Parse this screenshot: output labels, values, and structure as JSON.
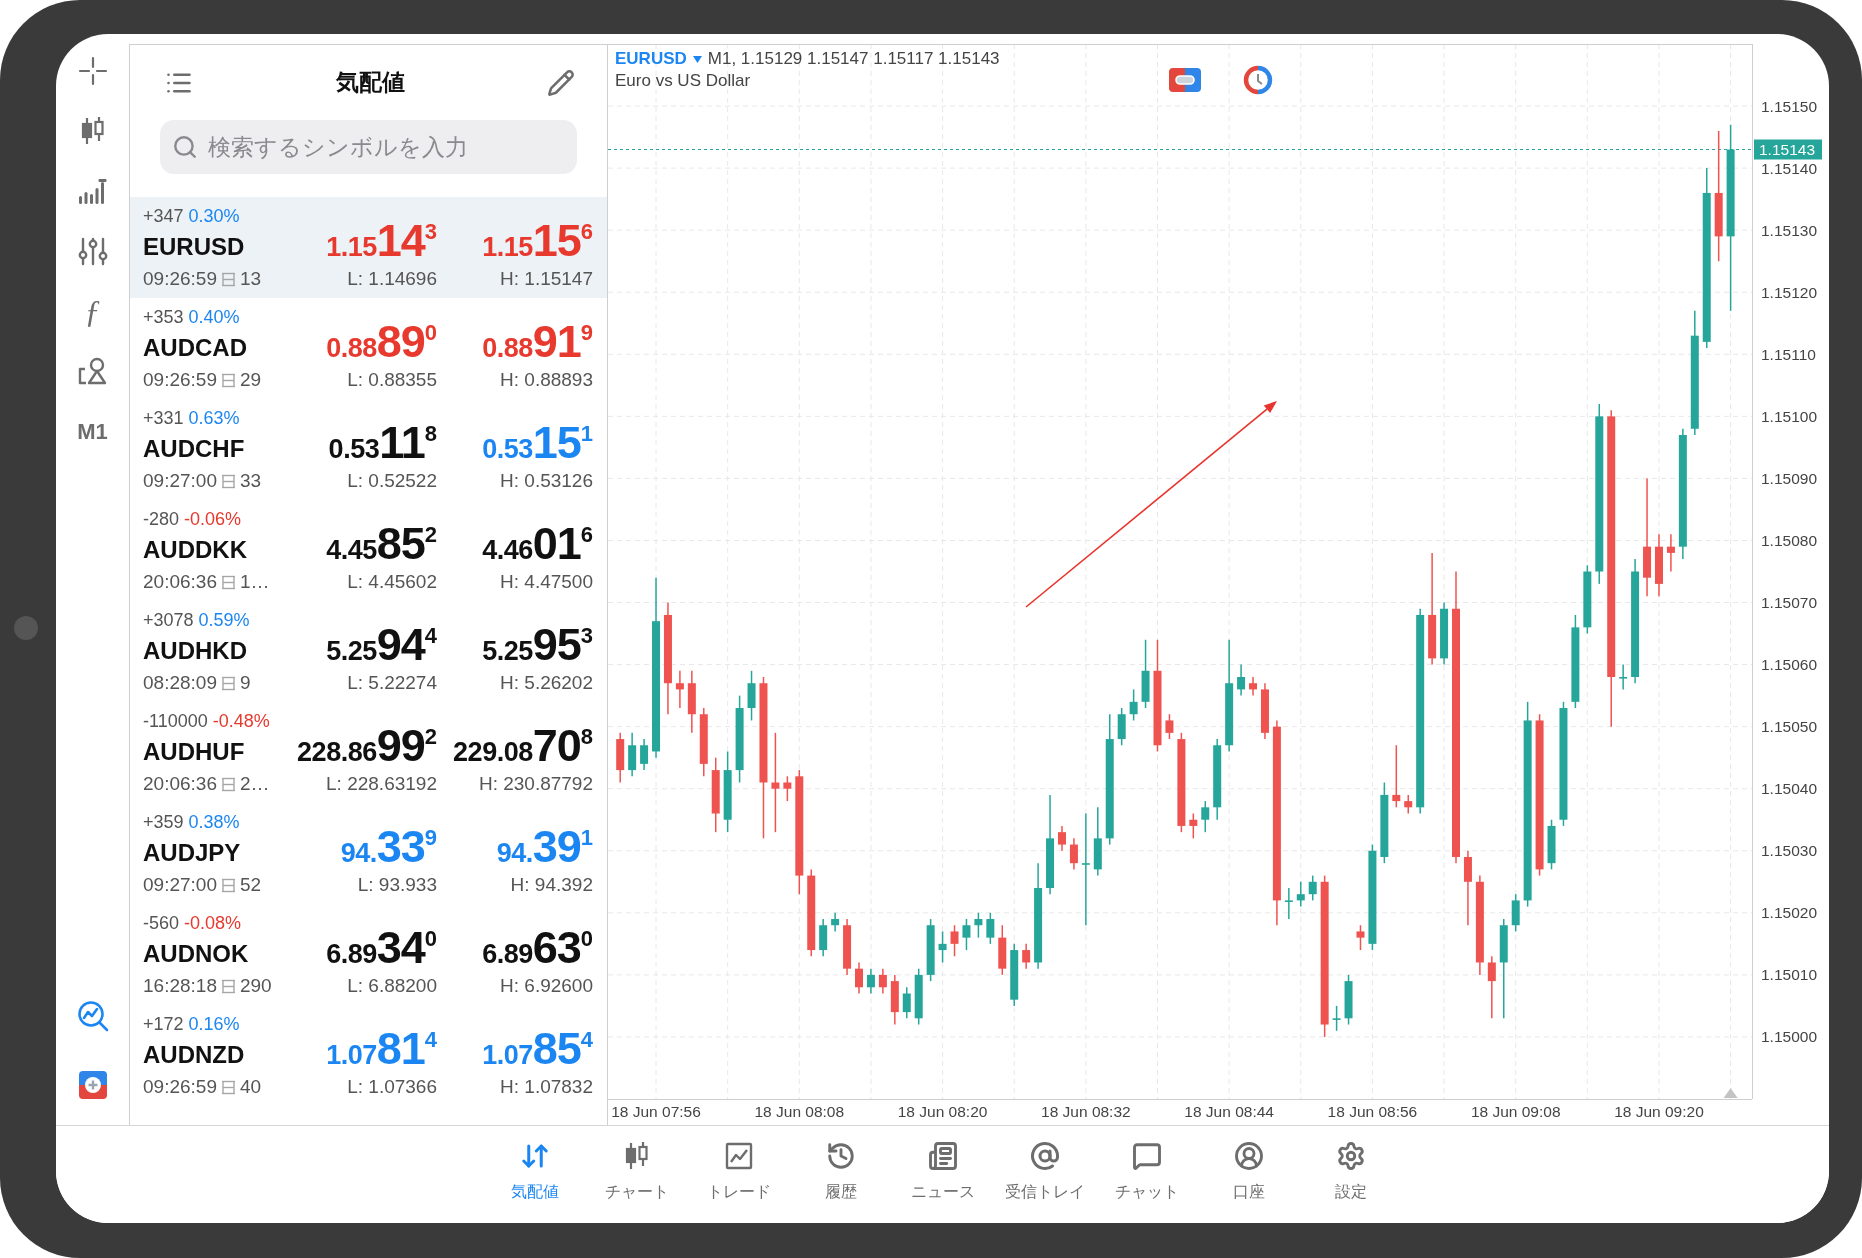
{
  "toolbar": {
    "function_glyph": "ƒ",
    "timeframe": "M1"
  },
  "quotes": {
    "title": "気配値",
    "search": {
      "placeholder": "検索するシンボルを入力"
    },
    "rows": [
      {
        "symbol": "EURUSD",
        "change": "+347",
        "change_percent": "0.30%",
        "color": "#1b86f2",
        "time": "09:26:59",
        "spread": "13",
        "bid": {
          "prefix": "1.15",
          "main": "14",
          "pip": "3",
          "color": "#e7392e"
        },
        "low": "L: 1.14696",
        "ask": {
          "prefix": "1.15",
          "main": "15",
          "pip": "6",
          "color": "#e7392e"
        },
        "high": "H: 1.15147",
        "selected": true
      },
      {
        "symbol": "AUDCAD",
        "change": "+353",
        "change_percent": "0.40%",
        "color": "#1b86f2",
        "time": "09:26:59",
        "spread": "29",
        "bid": {
          "prefix": "0.88",
          "main": "89",
          "pip": "0",
          "color": "#e7392e"
        },
        "low": "L: 0.88355",
        "ask": {
          "prefix": "0.88",
          "main": "91",
          "pip": "9",
          "color": "#e7392e"
        },
        "high": "H: 0.88893",
        "selected": false
      },
      {
        "symbol": "AUDCHF",
        "change": "+331",
        "change_percent": "0.63%",
        "color": "#1b86f2",
        "time": "09:27:00",
        "spread": "33",
        "bid": {
          "prefix": "0.53",
          "main": "11",
          "pip": "8",
          "color": "#111111"
        },
        "low": "L: 0.52522",
        "ask": {
          "prefix": "0.53",
          "main": "15",
          "pip": "1",
          "color": "#1b86f2"
        },
        "high": "H: 0.53126",
        "selected": false
      },
      {
        "symbol": "AUDDKK",
        "change": "-280",
        "change_percent": "-0.06%",
        "color": "#e7392e",
        "time": "20:06:36",
        "spread": "1…",
        "bid": {
          "prefix": "4.45",
          "main": "85",
          "pip": "2",
          "color": "#111111"
        },
        "low": "L: 4.45602",
        "ask": {
          "prefix": "4.46",
          "main": "01",
          "pip": "6",
          "color": "#111111"
        },
        "high": "H: 4.47500",
        "selected": false
      },
      {
        "symbol": "AUDHKD",
        "change": "+3078",
        "change_percent": "0.59%",
        "color": "#1b86f2",
        "time": "08:28:09",
        "spread": "9",
        "bid": {
          "prefix": "5.25",
          "main": "94",
          "pip": "4",
          "color": "#111111"
        },
        "low": "L: 5.22274",
        "ask": {
          "prefix": "5.25",
          "main": "95",
          "pip": "3",
          "color": "#111111"
        },
        "high": "H: 5.26202",
        "selected": false
      },
      {
        "symbol": "AUDHUF",
        "change": "-110000",
        "change_percent": "-0.48%",
        "color": "#e7392e",
        "time": "20:06:36",
        "spread": "2…",
        "bid": {
          "prefix": "228.86",
          "main": "99",
          "pip": "2",
          "color": "#111111"
        },
        "low": "L: 228.63192",
        "ask": {
          "prefix": "229.08",
          "main": "70",
          "pip": "8",
          "color": "#111111"
        },
        "high": "H: 230.87792",
        "selected": false
      },
      {
        "symbol": "AUDJPY",
        "change": "+359",
        "change_percent": "0.38%",
        "color": "#1b86f2",
        "time": "09:27:00",
        "spread": "52",
        "bid": {
          "prefix": "94.",
          "main": "33",
          "pip": "9",
          "color": "#1b86f2"
        },
        "low": "L: 93.933",
        "ask": {
          "prefix": "94.",
          "main": "39",
          "pip": "1",
          "color": "#1b86f2"
        },
        "high": "H: 94.392",
        "selected": false
      },
      {
        "symbol": "AUDNOK",
        "change": "-560",
        "change_percent": "-0.08%",
        "color": "#e7392e",
        "time": "16:28:18",
        "spread": "290",
        "bid": {
          "prefix": "6.89",
          "main": "34",
          "pip": "0",
          "color": "#111111"
        },
        "low": "L: 6.88200",
        "ask": {
          "prefix": "6.89",
          "main": "63",
          "pip": "0",
          "color": "#111111"
        },
        "high": "H: 6.92600",
        "selected": false
      },
      {
        "symbol": "AUDNZD",
        "change": "+172",
        "change_percent": "0.16%",
        "color": "#1b86f2",
        "time": "09:26:59",
        "spread": "40",
        "bid": {
          "prefix": "1.07",
          "main": "81",
          "pip": "4",
          "color": "#1b86f2"
        },
        "low": "L: 1.07366",
        "ask": {
          "prefix": "1.07",
          "main": "85",
          "pip": "4",
          "color": "#1b86f2"
        },
        "high": "H: 1.07832",
        "selected": false
      }
    ]
  },
  "chart": {
    "symbol": "EURUSD",
    "summary": "M1, 1.15129 1.15147 1.15117 1.15143",
    "description": "Euro vs US Dollar",
    "chart_data": {
      "type": "candlestick",
      "grid": true,
      "categories": [
        null,
        null,
        null,
        "18 Jun 07:56",
        null,
        null,
        null,
        null,
        null,
        null,
        null,
        null,
        null,
        null,
        null,
        "18 Jun 08:08",
        null,
        null,
        null,
        null,
        null,
        null,
        null,
        null,
        null,
        null,
        null,
        "18 Jun 08:20",
        null,
        null,
        null,
        null,
        null,
        null,
        null,
        null,
        null,
        null,
        null,
        "18 Jun 08:32",
        null,
        null,
        null,
        null,
        null,
        null,
        null,
        null,
        null,
        null,
        null,
        "18 Jun 08:44",
        null,
        null,
        null,
        null,
        null,
        null,
        null,
        null,
        null,
        null,
        null,
        "18 Jun 08:56",
        null,
        null,
        null,
        null,
        null,
        null,
        null,
        null,
        null,
        null,
        null,
        "18 Jun 09:08",
        null,
        null,
        null,
        null,
        null,
        null,
        null,
        null,
        null,
        null,
        null,
        "18 Jun 09:20",
        null,
        null,
        null,
        null,
        null,
        null
      ],
      "ohlc": [
        [
          1.15048,
          1.15049,
          1.15041,
          1.15043
        ],
        [
          1.15043,
          1.15049,
          1.15042,
          1.15047
        ],
        [
          1.15044,
          1.15048,
          1.15043,
          1.15047
        ],
        [
          1.15046,
          1.15074,
          1.15045,
          1.15067
        ],
        [
          1.15068,
          1.1507,
          1.15052,
          1.15057
        ],
        [
          1.15057,
          1.15059,
          1.15053,
          1.15056
        ],
        [
          1.15057,
          1.15059,
          1.15049,
          1.15052
        ],
        [
          1.15052,
          1.15053,
          1.15042,
          1.15044
        ],
        [
          1.15043,
          1.15045,
          1.15033,
          1.15036
        ],
        [
          1.15035,
          1.15046,
          1.15033,
          1.15043
        ],
        [
          1.15043,
          1.15055,
          1.15041,
          1.15053
        ],
        [
          1.15053,
          1.15059,
          1.15051,
          1.15057
        ],
        [
          1.15057,
          1.15058,
          1.15032,
          1.15041
        ],
        [
          1.15041,
          1.15049,
          1.15033,
          1.1504
        ],
        [
          1.15041,
          1.15042,
          1.15038,
          1.1504
        ],
        [
          1.15042,
          1.15043,
          1.15023,
          1.15026
        ],
        [
          1.15026,
          1.15027,
          1.15013,
          1.15014
        ],
        [
          1.15014,
          1.15019,
          1.15013,
          1.15018
        ],
        [
          1.15018,
          1.1502,
          1.15017,
          1.15019
        ],
        [
          1.15018,
          1.15019,
          1.1501,
          1.15011
        ],
        [
          1.15011,
          1.15012,
          1.15007,
          1.15008
        ],
        [
          1.15008,
          1.15011,
          1.15007,
          1.1501
        ],
        [
          1.1501,
          1.15011,
          1.15007,
          1.15008
        ],
        [
          1.15009,
          1.1501,
          1.15002,
          1.15004
        ],
        [
          1.15004,
          1.15008,
          1.15003,
          1.15007
        ],
        [
          1.15003,
          1.15011,
          1.15002,
          1.1501
        ],
        [
          1.1501,
          1.15019,
          1.15009,
          1.15018
        ],
        [
          1.15014,
          1.15017,
          1.15012,
          1.15015
        ],
        [
          1.15017,
          1.15018,
          1.15013,
          1.15015
        ],
        [
          1.15016,
          1.15019,
          1.15014,
          1.15018
        ],
        [
          1.15018,
          1.1502,
          1.15016,
          1.15019
        ],
        [
          1.15016,
          1.1502,
          1.15015,
          1.15019
        ],
        [
          1.15016,
          1.15018,
          1.1501,
          1.15011
        ],
        [
          1.15006,
          1.15015,
          1.15005,
          1.15014
        ],
        [
          1.15014,
          1.15015,
          1.15011,
          1.15012
        ],
        [
          1.15012,
          1.15028,
          1.15011,
          1.15024
        ],
        [
          1.15024,
          1.15039,
          1.15023,
          1.15032
        ],
        [
          1.15033,
          1.15034,
          1.1503,
          1.15031
        ],
        [
          1.15031,
          1.15032,
          1.15027,
          1.15028
        ],
        [
          1.15028,
          1.15036,
          1.15018,
          1.15028
        ],
        [
          1.15027,
          1.15037,
          1.15026,
          1.15032
        ],
        [
          1.15032,
          1.15052,
          1.15031,
          1.15048
        ],
        [
          1.15048,
          1.15053,
          1.15047,
          1.15052
        ],
        [
          1.15052,
          1.15056,
          1.15051,
          1.15054
        ],
        [
          1.15054,
          1.15064,
          1.15053,
          1.15059
        ],
        [
          1.15059,
          1.15064,
          1.15046,
          1.15047
        ],
        [
          1.15051,
          1.15052,
          1.15048,
          1.15049
        ],
        [
          1.15048,
          1.15049,
          1.15033,
          1.15034
        ],
        [
          1.15035,
          1.15036,
          1.15032,
          1.15034
        ],
        [
          1.15035,
          1.15038,
          1.15033,
          1.15037
        ],
        [
          1.15037,
          1.15048,
          1.15035,
          1.15047
        ],
        [
          1.15047,
          1.15064,
          1.15046,
          1.15057
        ],
        [
          1.15056,
          1.1506,
          1.15055,
          1.15058
        ],
        [
          1.15057,
          1.15058,
          1.15055,
          1.15056
        ],
        [
          1.15056,
          1.15057,
          1.15048,
          1.15049
        ],
        [
          1.1505,
          1.15051,
          1.15018,
          1.15022
        ],
        [
          1.15022,
          1.15024,
          1.15019,
          1.15022
        ],
        [
          1.15022,
          1.15025,
          1.15021,
          1.15023
        ],
        [
          1.15023,
          1.15026,
          1.15022,
          1.15025
        ],
        [
          1.15025,
          1.15026,
          1.15,
          1.15002
        ],
        [
          1.15003,
          1.15005,
          1.15001,
          1.15003
        ],
        [
          1.15003,
          1.1501,
          1.15002,
          1.15009
        ],
        [
          1.15017,
          1.15018,
          1.15014,
          1.15016
        ],
        [
          1.15015,
          1.15031,
          1.15014,
          1.1503
        ],
        [
          1.15029,
          1.15041,
          1.15028,
          1.15039
        ],
        [
          1.15039,
          1.15047,
          1.15037,
          1.15038
        ],
        [
          1.15038,
          1.15039,
          1.15036,
          1.15037
        ],
        [
          1.15037,
          1.15069,
          1.15036,
          1.15068
        ],
        [
          1.15068,
          1.15078,
          1.1506,
          1.15061
        ],
        [
          1.15061,
          1.1507,
          1.1506,
          1.15069
        ],
        [
          1.15069,
          1.15075,
          1.15028,
          1.15029
        ],
        [
          1.15029,
          1.1503,
          1.15018,
          1.15025
        ],
        [
          1.15025,
          1.15026,
          1.1501,
          1.15012
        ],
        [
          1.15012,
          1.15013,
          1.15003,
          1.15009
        ],
        [
          1.15012,
          1.15019,
          1.15003,
          1.15018
        ],
        [
          1.15018,
          1.15023,
          1.15017,
          1.15022
        ],
        [
          1.15022,
          1.15054,
          1.15021,
          1.15051
        ],
        [
          1.15051,
          1.15052,
          1.15026,
          1.15027
        ],
        [
          1.15028,
          1.15035,
          1.15027,
          1.15034
        ],
        [
          1.15035,
          1.15054,
          1.15034,
          1.15053
        ],
        [
          1.15054,
          1.15068,
          1.15053,
          1.15066
        ],
        [
          1.15066,
          1.15076,
          1.15065,
          1.15075
        ],
        [
          1.15075,
          1.15102,
          1.15073,
          1.151
        ],
        [
          1.151,
          1.15101,
          1.1505,
          1.15058
        ],
        [
          1.15058,
          1.1506,
          1.15056,
          1.15058
        ],
        [
          1.15058,
          1.15077,
          1.15057,
          1.15075
        ],
        [
          1.15079,
          1.1509,
          1.15071,
          1.15074
        ],
        [
          1.15079,
          1.15081,
          1.15071,
          1.15073
        ],
        [
          1.15079,
          1.15081,
          1.15075,
          1.15078
        ],
        [
          1.15079,
          1.15098,
          1.15077,
          1.15097
        ],
        [
          1.15098,
          1.15117,
          1.15097,
          1.15113
        ],
        [
          1.15112,
          1.1514,
          1.15111,
          1.15136
        ],
        [
          1.15136,
          1.15146,
          1.15125,
          1.15129
        ],
        [
          1.15129,
          1.15147,
          1.15117,
          1.15143
        ]
      ],
      "ylim": [
        1.1499,
        1.1516
      ],
      "yticks": [
        {
          "value": 1.1515,
          "label": "1.15150"
        },
        {
          "value": 1.1514,
          "label": "1.15140"
        },
        {
          "value": 1.1513,
          "label": "1.15130"
        },
        {
          "value": 1.1512,
          "label": "1.15120"
        },
        {
          "value": 1.1511,
          "label": "1.15110"
        },
        {
          "value": 1.151,
          "label": "1.15100"
        },
        {
          "value": 1.1509,
          "label": "1.15090"
        },
        {
          "value": 1.1508,
          "label": "1.15080"
        },
        {
          "value": 1.1507,
          "label": "1.15070"
        },
        {
          "value": 1.1506,
          "label": "1.15060"
        },
        {
          "value": 1.1505,
          "label": "1.15050"
        },
        {
          "value": 1.1504,
          "label": "1.15040"
        },
        {
          "value": 1.1503,
          "label": "1.15030"
        },
        {
          "value": 1.1502,
          "label": "1.15020"
        },
        {
          "value": 1.1501,
          "label": "1.15010"
        },
        {
          "value": 1.15,
          "label": "1.15000"
        }
      ],
      "ref_lines": [
        {
          "axis": "y",
          "value": 1.15143,
          "label": "1.15143"
        }
      ]
    }
  },
  "tabs": [
    {
      "label": "気配値",
      "selected": true
    },
    {
      "label": "チャート",
      "selected": false
    },
    {
      "label": "トレード",
      "selected": false
    },
    {
      "label": "履歴",
      "selected": false
    },
    {
      "label": "ニュース",
      "selected": false
    },
    {
      "label": "受信トレイ",
      "selected": false
    },
    {
      "label": "チャット",
      "selected": false
    },
    {
      "label": "口座",
      "selected": false
    },
    {
      "label": "設定",
      "selected": false
    }
  ]
}
